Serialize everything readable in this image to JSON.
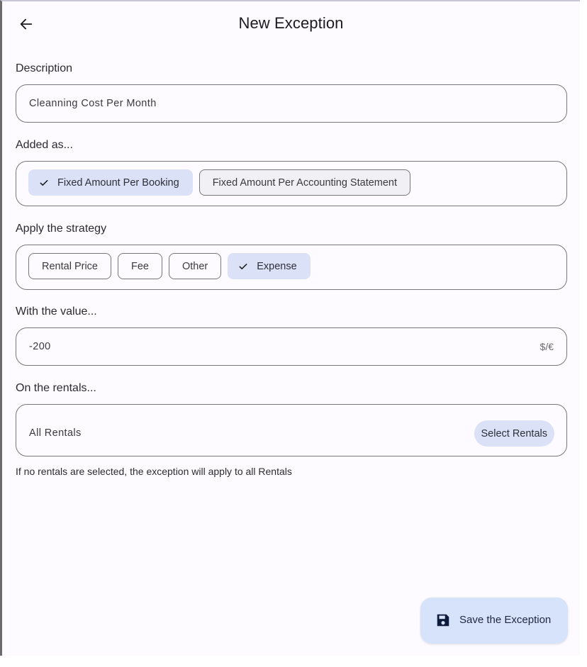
{
  "header": {
    "title": "New Exception",
    "back_icon": "arrow-left-icon"
  },
  "description": {
    "label": "Description",
    "value": "Cleanning Cost Per Month"
  },
  "added_as": {
    "label": "Added as...",
    "options": [
      {
        "label": "Fixed Amount Per Booking",
        "selected": true
      },
      {
        "label": "Fixed Amount Per Accounting Statement",
        "selected": false
      }
    ]
  },
  "strategy": {
    "label": "Apply the strategy",
    "options": [
      {
        "label": "Rental Price",
        "selected": false
      },
      {
        "label": "Fee",
        "selected": false
      },
      {
        "label": "Other",
        "selected": false
      },
      {
        "label": "Expense",
        "selected": true
      }
    ]
  },
  "value": {
    "label": "With the value...",
    "value": "-200",
    "suffix": "$/€"
  },
  "rentals": {
    "label": "On the rentals...",
    "value": "All Rentals",
    "button_label": "Select Rentals",
    "helper": "If no rentals are selected, the exception will apply to all Rentals"
  },
  "save": {
    "label": "Save the Exception",
    "icon": "save-floppy-icon"
  },
  "colors": {
    "background": "#fdfbff",
    "selected_chip": "#dbe2f8",
    "fab": "#d6e3fb",
    "outline": "#77767a",
    "icon_dark": "#0f1b3d"
  }
}
